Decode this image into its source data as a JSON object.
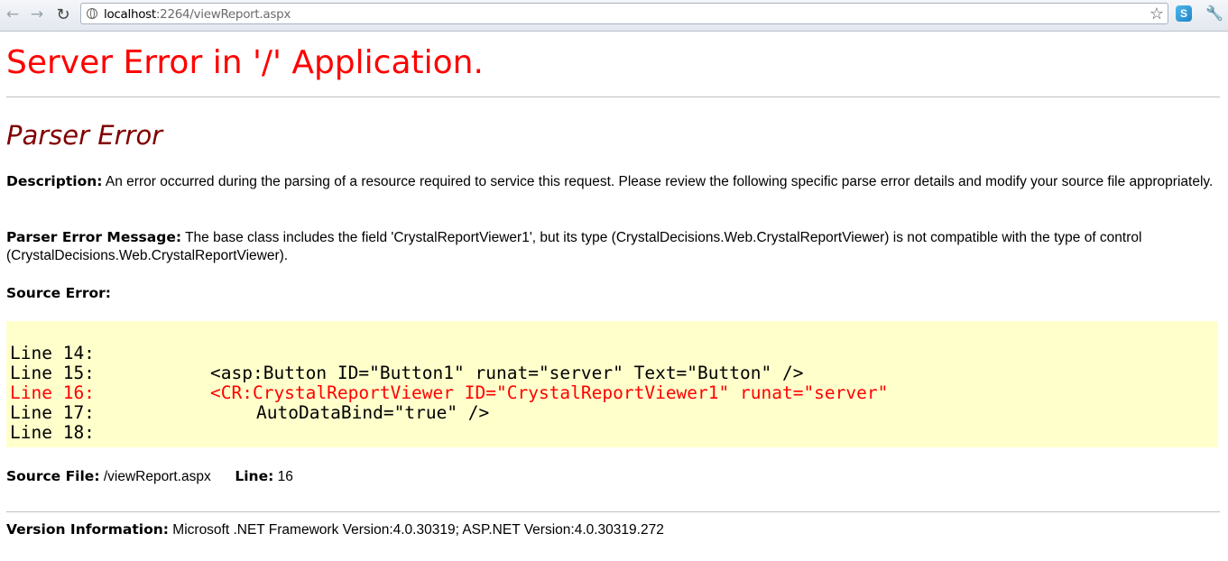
{
  "browser": {
    "back_icon": "back-arrow-icon",
    "forward_icon": "forward-arrow-icon",
    "reload_icon": "reload-icon",
    "url_host": "localhost",
    "url_rest": ":2264/viewReport.aspx"
  },
  "error": {
    "title": "Server Error in '/' Application.",
    "subtitle": "Parser Error",
    "description_label": "Description:",
    "description_text": "An error occurred during the parsing of a resource required to service this request. Please review the following specific parse error details and modify your source file appropriately.",
    "message_label": "Parser Error Message:",
    "message_text": "The base class includes the field 'CrystalReportViewer1', but its type (CrystalDecisions.Web.CrystalReportViewer) is not compatible with the type of control (CrystalDecisions.Web.CrystalReportViewer).",
    "source_error_label": "Source Error:",
    "source_lines": [
      {
        "label": "Line 14:",
        "code": ""
      },
      {
        "label": "Line 15:",
        "code": "<asp:Button ID=\"Button1\" runat=\"server\" Text=\"Button\" />"
      },
      {
        "label": "Line 16:",
        "code": "<CR:CrystalReportViewer ID=\"CrystalReportViewer1\" runat=\"server\""
      },
      {
        "label": "Line 17:",
        "code": "AutoDataBind=\"true\" />"
      },
      {
        "label": "Line 18:",
        "code": ""
      }
    ],
    "source_file_label": "Source File:",
    "source_file_value": "/viewReport.aspx",
    "line_label": "Line:",
    "line_value": "16",
    "version_label": "Version Information:",
    "version_text": "Microsoft .NET Framework Version:4.0.30319; ASP.NET Version:4.0.30319.272"
  },
  "colors": {
    "title": "#ff0000",
    "subtitle": "#800000",
    "error_line": "#ff0000",
    "code_background": "#ffffcc"
  }
}
